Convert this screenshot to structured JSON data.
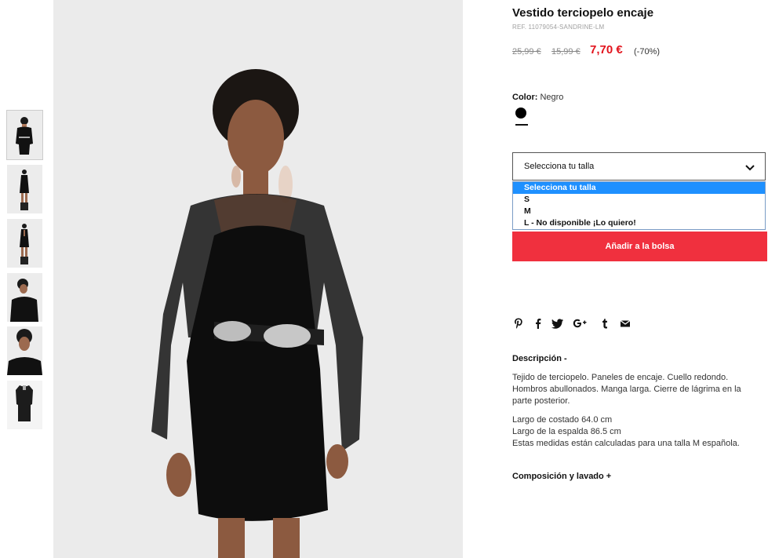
{
  "product": {
    "title": "Vestido terciopelo encaje",
    "ref": "REF. 11079054-SANDRINE-LM",
    "price_old_1": "25,99 €",
    "price_old_2": "15,99 €",
    "price_current": "7,70 €",
    "discount": "(-70%)"
  },
  "color": {
    "label": "Color:",
    "value": "Negro",
    "swatch": "#000000"
  },
  "size": {
    "select_label": "Selecciona tu talla",
    "options": [
      {
        "label": "Selecciona tu talla",
        "selected": true
      },
      {
        "label": "S"
      },
      {
        "label": "M"
      },
      {
        "label": "L - No disponible ¡Lo quiero!"
      }
    ]
  },
  "actions": {
    "add_to_bag": "Añadir a la bolsa"
  },
  "share": [
    "pinterest-icon",
    "facebook-icon",
    "twitter-icon",
    "google-plus-icon",
    "tumblr-icon",
    "email-icon"
  ],
  "description": {
    "heading": "Descripción -",
    "lines_1": [
      "Tejido de terciopelo. Paneles de encaje. Cuello redondo.",
      "Hombros abullonados. Manga larga. Cierre de lágrima en la",
      "parte posterior."
    ],
    "lines_2": [
      "Largo de costado 64.0 cm",
      "Largo de la espalda 86.5 cm",
      "Estas medidas están calculadas para una talla M española."
    ]
  },
  "composition": {
    "heading": "Composición y lavado +"
  },
  "colors": {
    "accent_red": "#e2141d",
    "button_red": "#f0303e",
    "dropdown_highlight": "#1e90ff"
  }
}
